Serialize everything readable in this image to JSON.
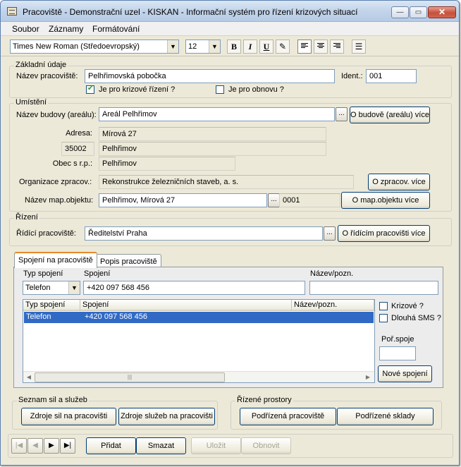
{
  "window": {
    "title": "Pracoviště - Demonstrační uzel - KISKAN - Informační systém pro řízení krizových situací",
    "minimize": "—",
    "maximize": "▭",
    "close": "✕"
  },
  "menu": [
    "Soubor",
    "Záznamy",
    "Formátování"
  ],
  "toolbar": {
    "font": "Times New Roman (Středoevropský)",
    "size": "12",
    "bold": "B",
    "italic": "I",
    "underline": "U"
  },
  "basic": {
    "group_label": "Základní údaje",
    "name_label": "Název pracoviště:",
    "name_value": "Pelhřimovská pobočka",
    "ident_label": "Ident.:",
    "ident_value": "001",
    "crisis_label": "Je pro krizové řízení ?",
    "crisis_checked": true,
    "renewal_label": "Je pro obnovu ?",
    "renewal_checked": false
  },
  "location": {
    "group_label": "Umístění",
    "building_label": "Název budovy (areálu):",
    "building_value": "Areál Pelhřimov",
    "building_btn": "O budově (areálu) více",
    "address_label": "Adresa:",
    "address_value": "Mírová 27",
    "zip_value": "35002",
    "city_value": "Pelhřimov",
    "municipality_label": "Obec s r.p.:",
    "municipality_value": "Pelhřimov",
    "org_label": "Organizace zpracov.:",
    "org_value": "Rekonstrukce železničních staveb, a. s.",
    "org_btn": "O zpracov. více",
    "map_label": "Název map.objektu:",
    "map_value": "Pelhřimov, Mírová 27",
    "map_code": "0001",
    "map_btn": "O map.objektu více",
    "dots": "..."
  },
  "control": {
    "group_label": "Řízení",
    "label": "Řídící pracoviště:",
    "value": "Ředitelství Praha",
    "btn": "O řídícím pracovišti více"
  },
  "tabs": [
    "Spojení na pracoviště",
    "Popis pracoviště"
  ],
  "connection": {
    "type_label": "Typ spojení",
    "type_value": "Telefon",
    "conn_label": "Spojení",
    "conn_value": "+420 097 568 456",
    "note_label": "Název/pozn.",
    "note_value": "",
    "columns": [
      "Typ spojení",
      "Spojení",
      "Název/pozn."
    ],
    "rows": [
      {
        "type": "Telefon",
        "conn": "+420 097 568 456",
        "note": ""
      }
    ],
    "crisis_label": "Krizové ?",
    "sms_label": "Dlouhá SMS ?",
    "order_label": "Poř.spoje",
    "order_value": "",
    "new_btn": "Nové spojení"
  },
  "resources": {
    "group_label": "Seznam sil a služeb",
    "btn1": "Zdroje sil  na pracovišti",
    "btn2": "Zdroje služeb na pracovišti"
  },
  "spaces": {
    "group_label": "Řízené prostory",
    "btn1": "Podřízená pracoviště",
    "btn2": "Podřízené sklady"
  },
  "footer": {
    "add": "Přidat",
    "delete": "Smazat",
    "save": "Uložit",
    "restore": "Obnovit"
  }
}
